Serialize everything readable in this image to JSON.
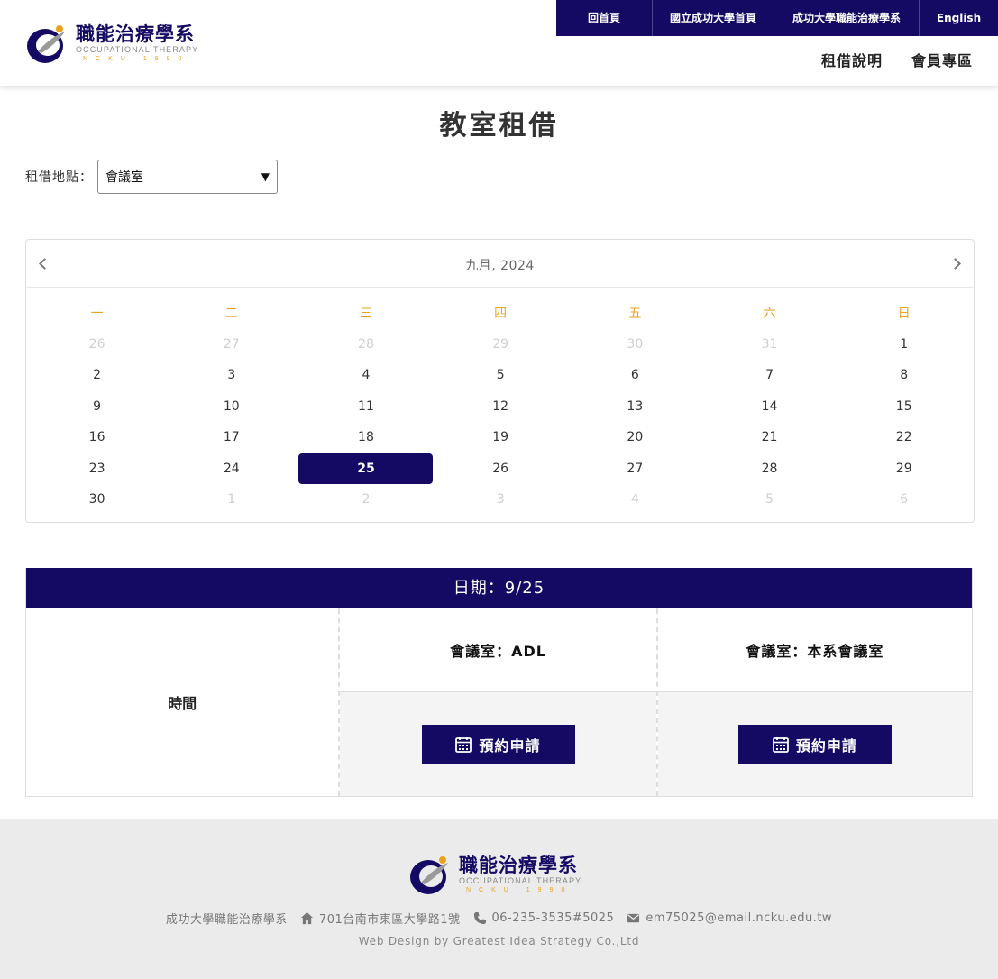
{
  "brand": {
    "name_cn": "職能治療學系",
    "name_en": "OCCUPATIONAL THERAPY",
    "subline": "NCKU 1990",
    "primary_color": "#140a63",
    "accent_color": "#e8a21c"
  },
  "top_nav": [
    {
      "label": "回首頁",
      "width": 106
    },
    {
      "label": "國立成功大學首頁",
      "width": 135
    },
    {
      "label": "成功大學職能治療學系",
      "width": 161
    },
    {
      "label": "English",
      "width": 88
    }
  ],
  "sub_nav": [
    "租借說明",
    "會員專區"
  ],
  "page_title": "教室租借",
  "location": {
    "label": "租借地點：",
    "selected": "會議室"
  },
  "calendar": {
    "month_label": "九月, 2024",
    "weekdays": [
      "一",
      "二",
      "三",
      "四",
      "五",
      "六",
      "日"
    ],
    "weeks": [
      [
        [
          "26",
          1
        ],
        [
          "27",
          1
        ],
        [
          "28",
          1
        ],
        [
          "29",
          1
        ],
        [
          "30",
          1
        ],
        [
          "31",
          1
        ],
        [
          "1",
          0
        ]
      ],
      [
        [
          "2",
          0
        ],
        [
          "3",
          0
        ],
        [
          "4",
          0
        ],
        [
          "5",
          0
        ],
        [
          "6",
          0
        ],
        [
          "7",
          0
        ],
        [
          "8",
          0
        ]
      ],
      [
        [
          "9",
          0
        ],
        [
          "10",
          0
        ],
        [
          "11",
          0
        ],
        [
          "12",
          0
        ],
        [
          "13",
          0
        ],
        [
          "14",
          0
        ],
        [
          "15",
          0
        ]
      ],
      [
        [
          "16",
          0
        ],
        [
          "17",
          0
        ],
        [
          "18",
          0
        ],
        [
          "19",
          0
        ],
        [
          "20",
          0
        ],
        [
          "21",
          0
        ],
        [
          "22",
          0
        ]
      ],
      [
        [
          "23",
          0
        ],
        [
          "24",
          0
        ],
        [
          "25",
          2
        ],
        [
          "26",
          0
        ],
        [
          "27",
          0
        ],
        [
          "28",
          0
        ],
        [
          "29",
          0
        ]
      ],
      [
        [
          "30",
          0
        ],
        [
          "1",
          1
        ],
        [
          "2",
          1
        ],
        [
          "3",
          1
        ],
        [
          "4",
          1
        ],
        [
          "5",
          1
        ],
        [
          "6",
          1
        ]
      ]
    ]
  },
  "booking": {
    "date_label": "日期：9/25",
    "time_header": "時間",
    "rooms": [
      {
        "name": "會議室：ADL",
        "button": "預約申請"
      },
      {
        "name": "會議室：本系會議室",
        "button": "預約申請"
      }
    ]
  },
  "footer": {
    "org": "成功大學職能治療學系",
    "address": "701台南市東區大學路1號",
    "phone": "06-235-3535#5025",
    "email": "em75025@email.ncku.edu.tw",
    "credit": "Web Design by Greatest Idea Strategy Co.,Ltd"
  }
}
